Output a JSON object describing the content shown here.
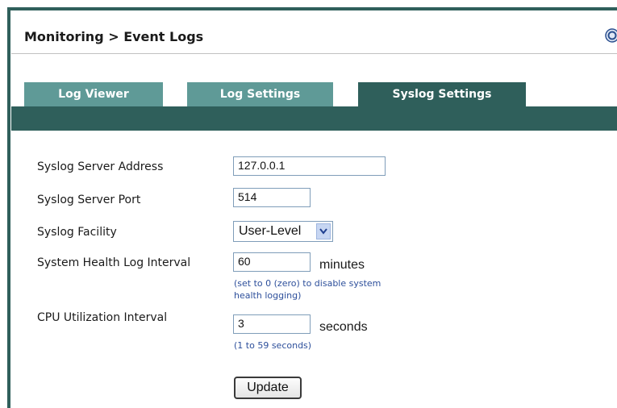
{
  "header": {
    "breadcrumb": "Monitoring > Event Logs"
  },
  "tabs": [
    {
      "label": "Log Viewer",
      "active": false
    },
    {
      "label": "Log Settings",
      "active": false
    },
    {
      "label": "Syslog Settings",
      "active": true
    }
  ],
  "form": {
    "server_address": {
      "label": "Syslog Server Address",
      "value": "127.0.0.1"
    },
    "server_port": {
      "label": "Syslog Server Port",
      "value": "514"
    },
    "facility": {
      "label": "Syslog Facility",
      "value": "User-Level"
    },
    "health_interval": {
      "label": "System Health Log Interval",
      "value": "60",
      "unit": "minutes",
      "hint_line1": "(set to 0 (zero) to disable system",
      "hint_line2": "health logging)"
    },
    "cpu_interval": {
      "label": "CPU Utilization Interval",
      "value": "3",
      "unit": "seconds",
      "hint": "(1 to 59 seconds)"
    },
    "update_label": "Update"
  },
  "colors": {
    "frame": "#2f5f5b",
    "tab_inactive": "#5f9a97",
    "tab_active": "#2f5f5b",
    "hint": "#2d4f9b"
  },
  "icons": {
    "help": "help-icon",
    "dropdown": "chevron-down-icon"
  }
}
